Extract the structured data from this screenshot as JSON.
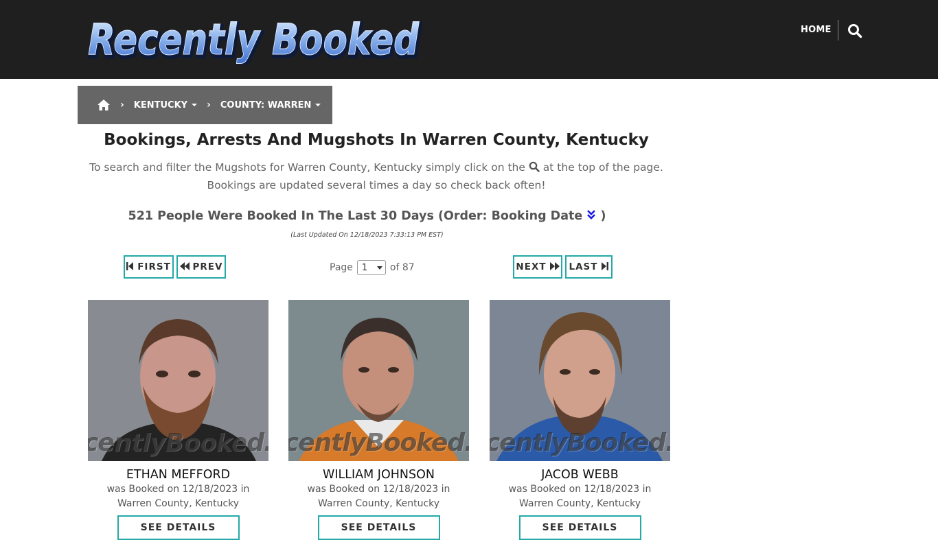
{
  "header": {
    "logo_text": "Recently Booked",
    "nav_home": "HOME",
    "search_icon": "search-icon"
  },
  "breadcrumb": {
    "home_icon": "home-icon",
    "state": "KENTUCKY",
    "county": "COUNTY: WARREN"
  },
  "main": {
    "title": "Bookings, Arrests And Mugshots In Warren County, Kentucky",
    "desc_part1": "To search and filter the Mugshots for Warren County, Kentucky simply click on the",
    "desc_part2": "at the top of the page.",
    "desc_line2": "Bookings are updated several times a day so check back often!",
    "count_prefix": "521 People Were Booked In The Last 30 Days (Order: Booking Date",
    "count_suffix": ")",
    "last_updated": "(Last Updated On 12/18/2023 7:33:13 PM EST)"
  },
  "pager": {
    "first": "FIRST",
    "prev": "PREV",
    "next": "NEXT",
    "last": "LAST",
    "page_label": "Page",
    "page_value": "1",
    "of_label": "of 87"
  },
  "watermark": "centlyBooked.co",
  "cards": [
    {
      "name": "ETHAN MEFFORD",
      "line1": "was Booked on 12/18/2023 in",
      "line2": "Warren County, Kentucky",
      "button": "SEE DETAILS"
    },
    {
      "name": "WILLIAM JOHNSON",
      "line1": "was Booked on 12/18/2023 in",
      "line2": "Warren County, Kentucky",
      "button": "SEE DETAILS"
    },
    {
      "name": "JACOB WEBB",
      "line1": "was Booked on 12/18/2023 in",
      "line2": "Warren County, Kentucky",
      "button": "SEE DETAILS"
    }
  ],
  "colors": {
    "header_bg": "#1f1f1f",
    "breadcrumb_bg": "#666666",
    "accent_border": "#22a9a8",
    "order_link": "#1a1ae6"
  }
}
